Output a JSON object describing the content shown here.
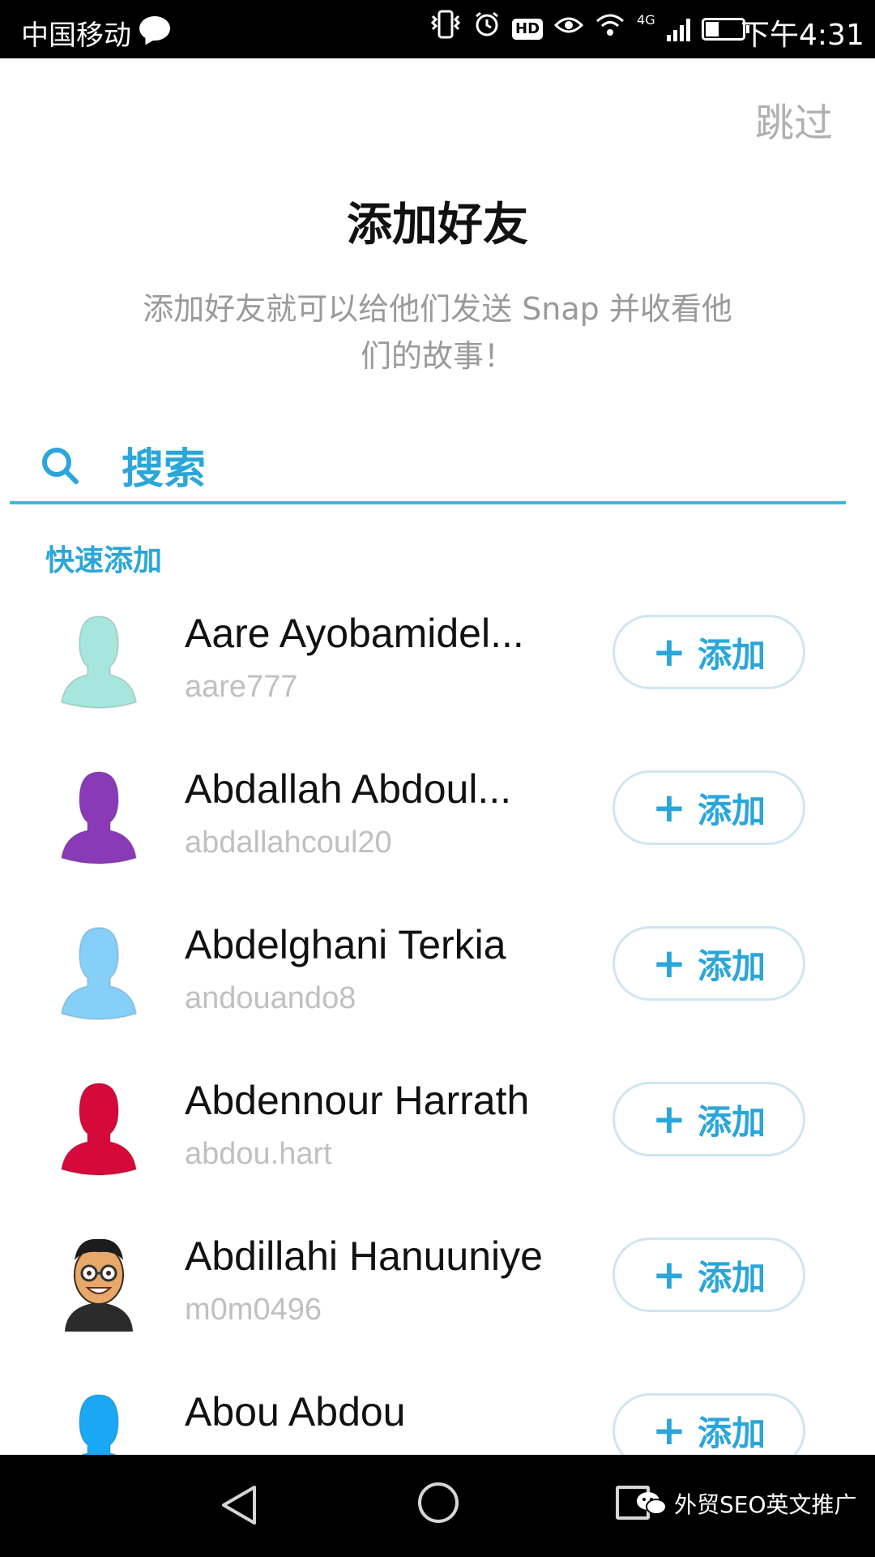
{
  "status_bar": {
    "carrier": "中国移动",
    "network": "4G",
    "hd_label": "HD",
    "time": "下午4:31"
  },
  "header": {
    "skip_label": "跳过",
    "title": "添加好友",
    "subtitle": "添加好友就可以给他们发送 Snap 并收看他们的故事！"
  },
  "search": {
    "placeholder": "搜索"
  },
  "quick_add": {
    "section_label": "快速添加",
    "add_label": "添加",
    "items": [
      {
        "name": "Aare Ayobamidel...",
        "username": "aare777",
        "avatar": "silhouette",
        "avatar_color": "#a6e6dc"
      },
      {
        "name": "Abdallah Abdoul...",
        "username": "abdallahcoul20",
        "avatar": "silhouette",
        "avatar_color": "#8b3ab7"
      },
      {
        "name": "Abdelghani Terkia",
        "username": "andouando8",
        "avatar": "silhouette",
        "avatar_color": "#86cff8"
      },
      {
        "name": "Abdennour Harrath",
        "username": "abdou.hart",
        "avatar": "silhouette",
        "avatar_color": "#d5093a"
      },
      {
        "name": "Abdillahi Hanuuniye",
        "username": "m0m0496",
        "avatar": "bitmoji",
        "avatar_color": "#e7a86a"
      },
      {
        "name": "Abou Abdou",
        "username": "",
        "avatar": "silhouette",
        "avatar_color": "#1aa8f5"
      }
    ]
  },
  "nav_bar": {
    "watermark": "外贸SEO英文推广"
  },
  "colors": {
    "accent": "#2aa6da",
    "button_border": "#cfe6f1",
    "muted_text": "#9a9a9a",
    "username_text": "#c0c0c0"
  }
}
